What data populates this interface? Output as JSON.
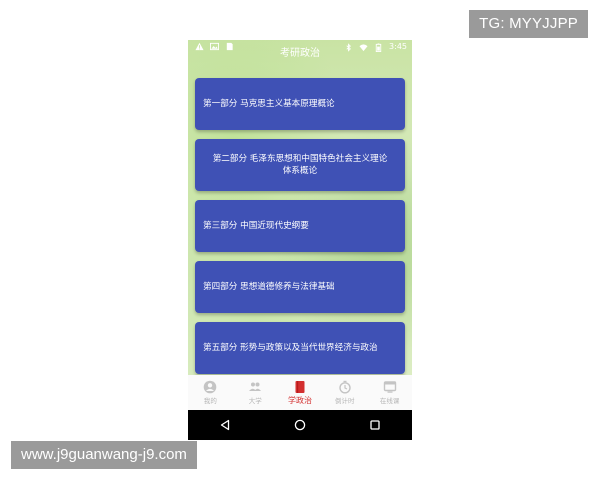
{
  "watermarks": {
    "tg": "TG: MYYJJPP",
    "url": "www.j9guanwang-j9.com"
  },
  "status_bar": {
    "time": "3:45",
    "left_icons": [
      "warning-icon",
      "image-icon",
      "sd-card-icon"
    ],
    "right_icons": [
      "bluetooth-icon",
      "wifi-icon",
      "battery-icon"
    ]
  },
  "app_bar": {
    "title": "考研政治"
  },
  "sections": [
    {
      "label": "第一部分 马克思主义基本原理概论"
    },
    {
      "label": "第二部分 毛泽东思想和中国特色社会主义理论体系概论"
    },
    {
      "label": "第三部分 中国近现代史纲要"
    },
    {
      "label": "第四部分 思想道德修养与法律基础"
    },
    {
      "label": "第五部分 形势与政策以及当代世界经济与政治"
    }
  ],
  "bottom_nav": {
    "items": [
      {
        "label": "我的",
        "icon": "person-icon",
        "active": false
      },
      {
        "label": "大学",
        "icon": "people-icon",
        "active": false
      },
      {
        "label": "学政治",
        "icon": "book-icon",
        "active": true
      },
      {
        "label": "倒计时",
        "icon": "timer-icon",
        "active": false
      },
      {
        "label": "在线课",
        "icon": "screen-icon",
        "active": false
      }
    ]
  },
  "colors": {
    "card": "#3f51b5",
    "active_nav": "#d32f2f",
    "inactive_nav": "#b5b5b5",
    "background": "#d6e8b8"
  }
}
